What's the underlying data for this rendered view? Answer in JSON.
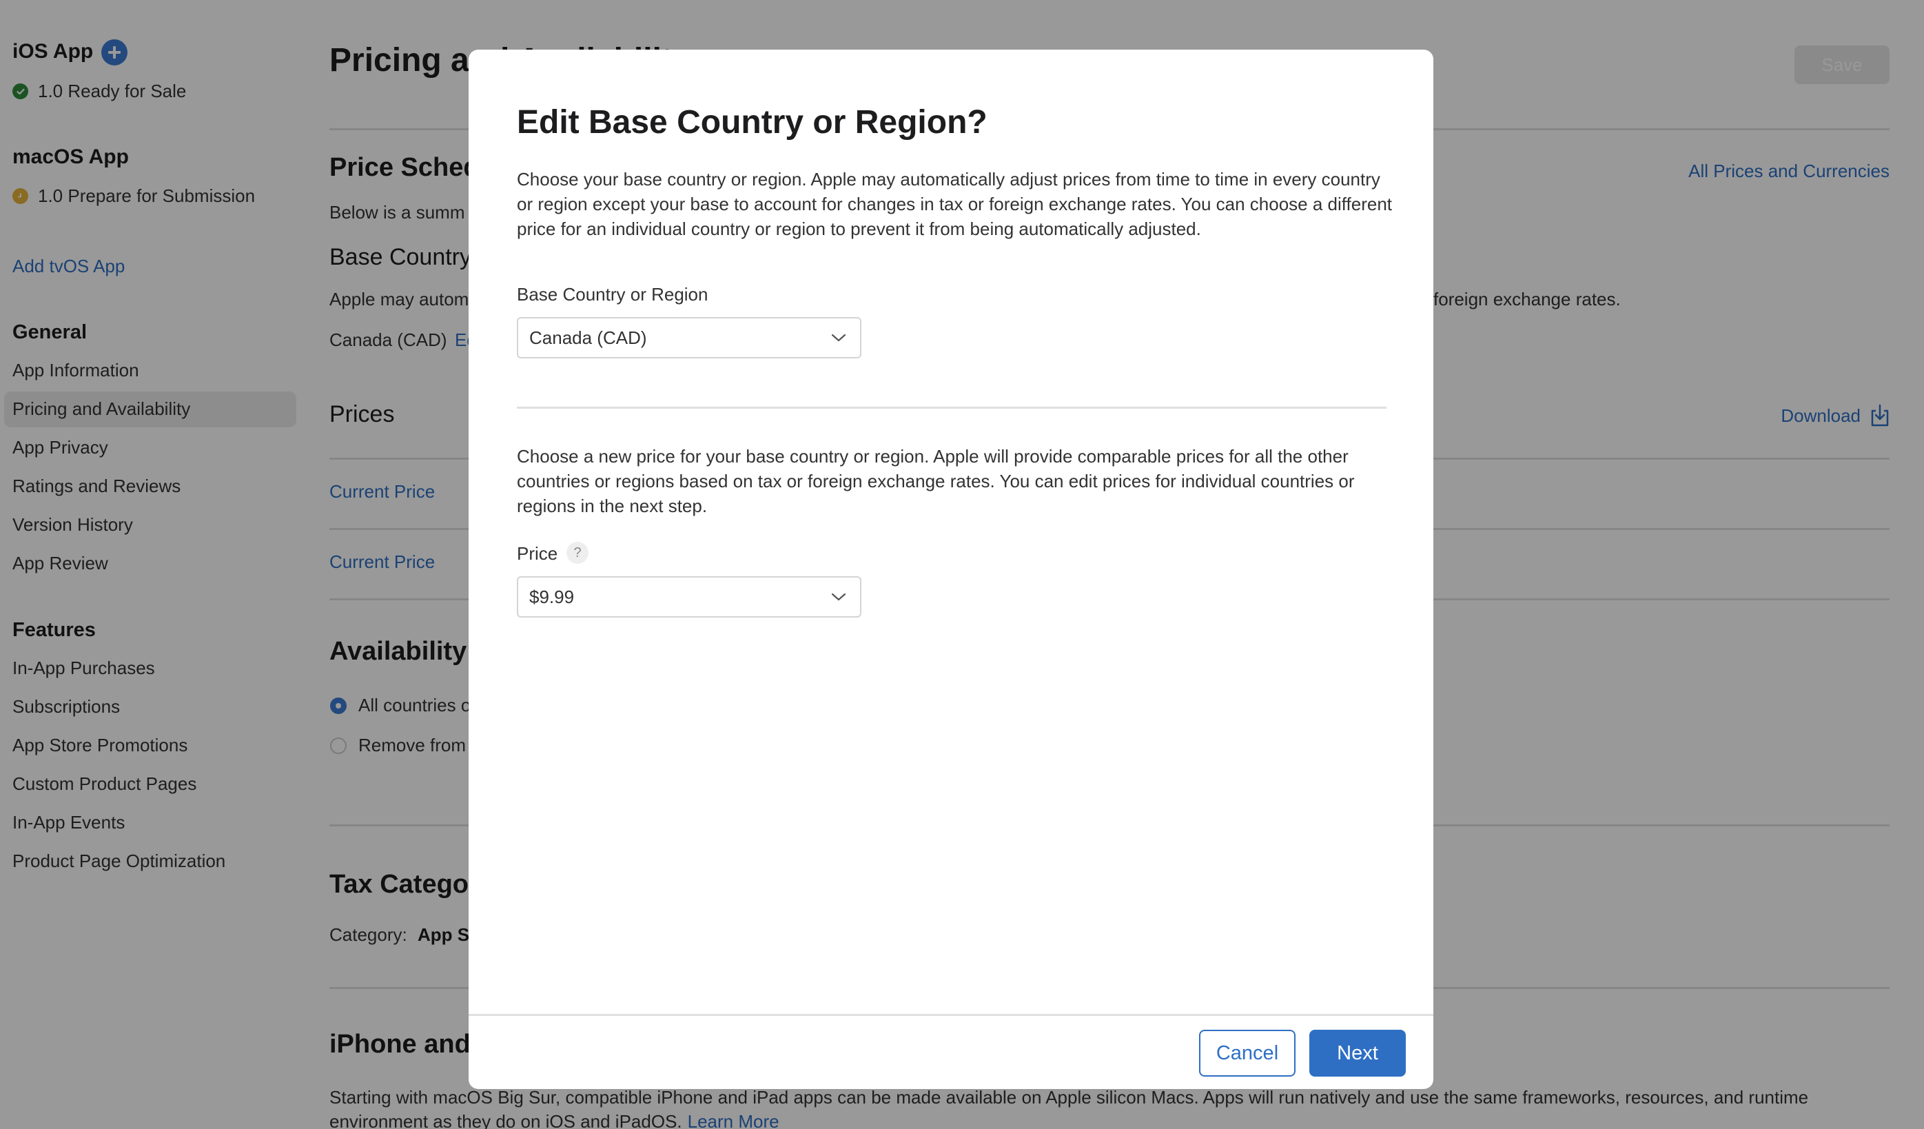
{
  "sidebar": {
    "ios_app": {
      "title": "iOS App",
      "add_icon": "plus-circle-icon",
      "status": "1.0 Ready for Sale",
      "status_icon": "checkmark-circle-icon",
      "status_color": "#2e8b3a"
    },
    "macos_app": {
      "title": "macOS App",
      "status": "1.0 Prepare for Submission",
      "status_icon": "clock-circle-icon",
      "status_color": "#e6b33a"
    },
    "add_tvos_label": "Add tvOS App",
    "sections": [
      {
        "title": "General",
        "items": [
          {
            "label": "App Information",
            "active": false
          },
          {
            "label": "Pricing and Availability",
            "active": true
          },
          {
            "label": "App Privacy",
            "active": false
          },
          {
            "label": "Ratings and Reviews",
            "active": false
          },
          {
            "label": "Version History",
            "active": false
          },
          {
            "label": "App Review",
            "active": false
          }
        ]
      },
      {
        "title": "Features",
        "items": [
          {
            "label": "In-App Purchases",
            "active": false
          },
          {
            "label": "Subscriptions",
            "active": false
          },
          {
            "label": "App Store Promotions",
            "active": false
          },
          {
            "label": "Custom Product Pages",
            "active": false
          },
          {
            "label": "In-App Events",
            "active": false
          },
          {
            "label": "Product Page Optimization",
            "active": false
          }
        ]
      }
    ]
  },
  "main": {
    "title": "Pricing and Availability",
    "save_label": "Save",
    "price_schedule": {
      "heading": "Price Schedule",
      "all_prices_link": "All Prices and Currencies",
      "summary_text": "Below is a summ",
      "base_country_heading": "Base Country or Region",
      "base_country_desc_start": "Apple may autom",
      "base_country_desc_end": "foreign exchange rates.",
      "base_country_value": "Canada (CAD)",
      "edit_link": "Edit"
    },
    "prices": {
      "heading": "Prices",
      "download_label": "Download",
      "download_icon": "download-icon",
      "rows": [
        {
          "label": "Current Price"
        },
        {
          "label": "Current Price"
        }
      ]
    },
    "availability": {
      "heading": "Availability",
      "options": [
        {
          "label": "All countries or regions",
          "selected": true
        },
        {
          "label": "Remove from sale",
          "selected": false
        }
      ]
    },
    "tax": {
      "heading": "Tax Category",
      "category_label": "Category:",
      "category_value": "App Store software"
    },
    "iphone_ipad": {
      "heading": "iPhone and iPad Apps on Apple Silicon Macs",
      "text": "Starting with macOS Big Sur, compatible iPhone and iPad apps can be made available on Apple silicon Macs. Apps will run natively and use the same frameworks, resources, and runtime",
      "text_line2": "environment as they do on iOS and iPadOS.",
      "learn_more": "Learn More"
    }
  },
  "modal": {
    "title": "Edit Base Country or Region?",
    "intro": "Choose your base country or region. Apple may automatically adjust prices from time to time in every country or region except your base to account for changes in tax or foreign exchange rates. You can choose a different price for an individual country or region to prevent it from being automatically adjusted.",
    "base_country_label": "Base Country or Region",
    "base_country_value": "Canada (CAD)",
    "price_intro": "Choose a new price for your base country or region. Apple will provide comparable prices for all the other countries or regions based on tax or foreign exchange rates. You can edit prices for individual countries or regions in the next step.",
    "price_label": "Price",
    "price_help_glyph": "?",
    "price_value": "$9.99",
    "cancel_label": "Cancel",
    "next_label": "Next"
  },
  "colors": {
    "accent": "#2e6fc4",
    "overlay": "rgba(0,0,0,0.40)"
  }
}
